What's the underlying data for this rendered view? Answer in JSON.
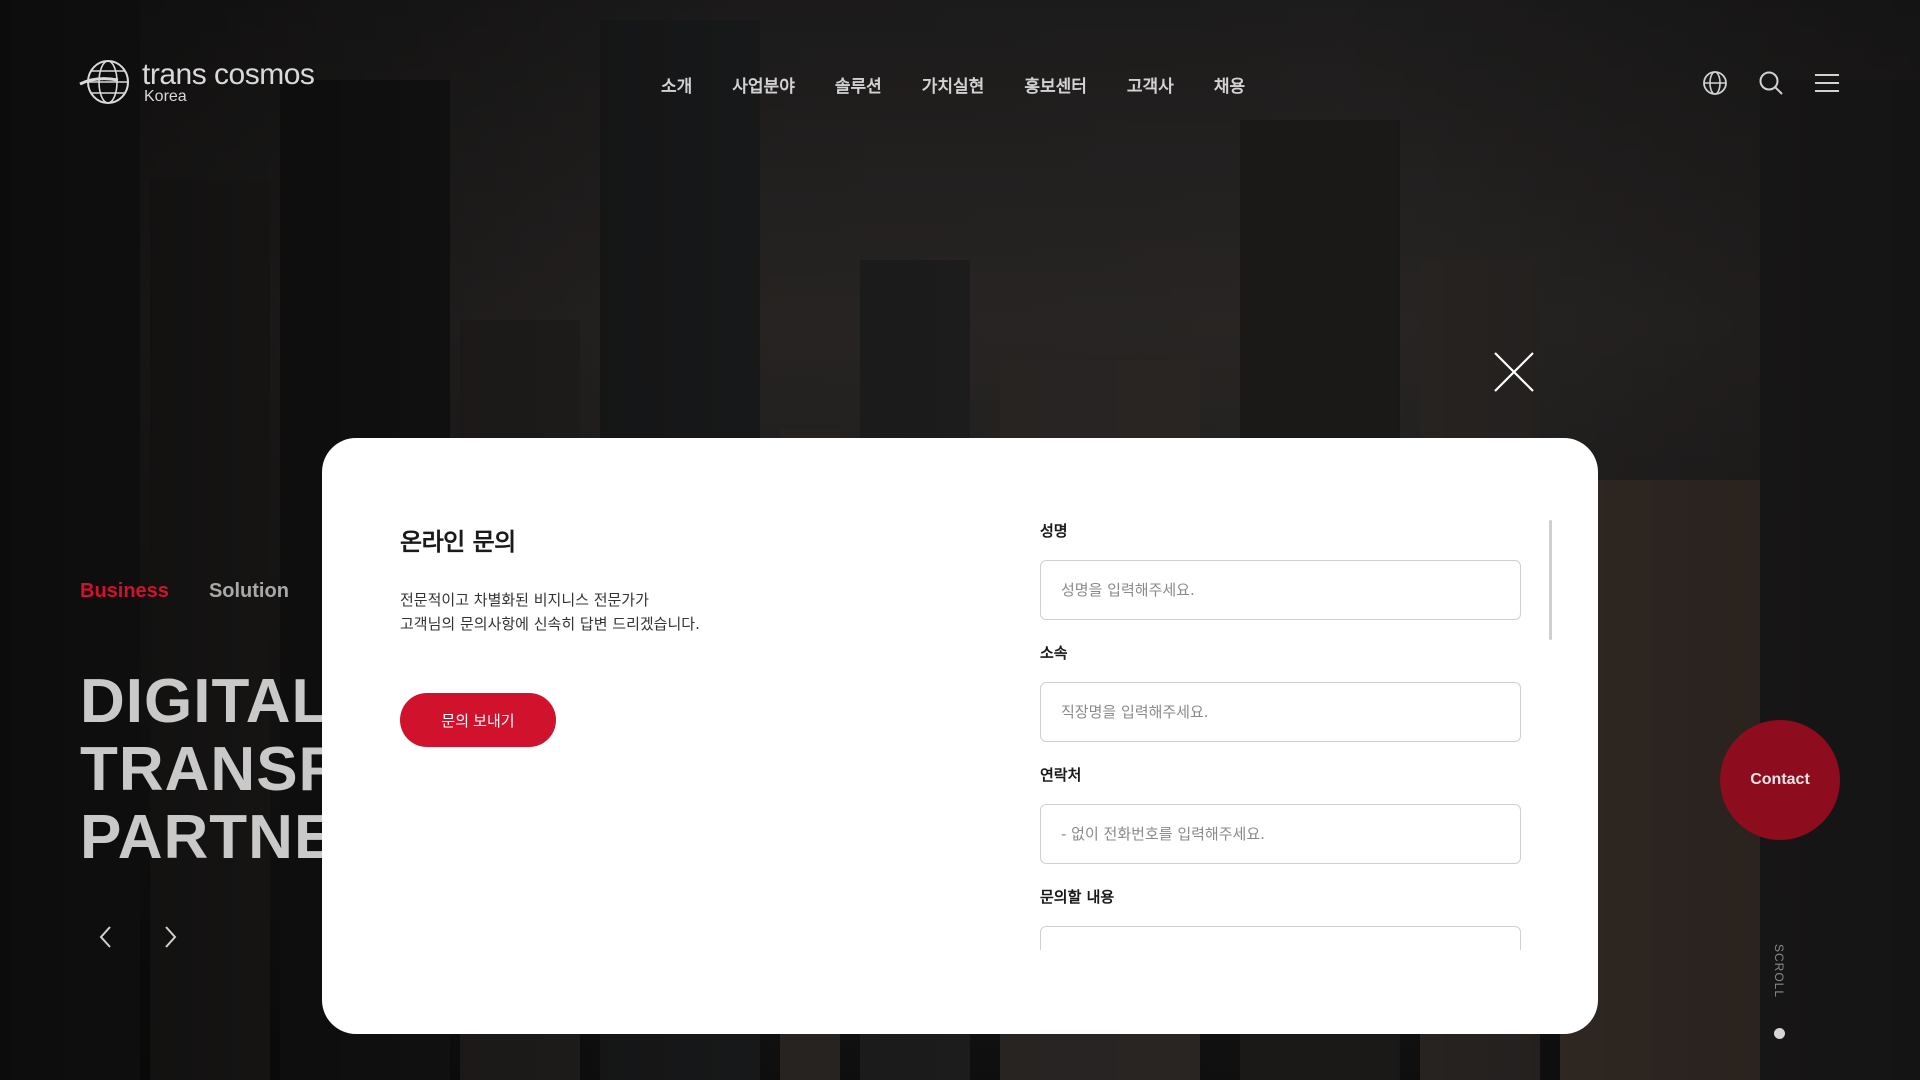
{
  "header": {
    "logo_main": "trans cosmos",
    "logo_sub": "Korea",
    "nav": [
      "소개",
      "사업분야",
      "솔루션",
      "가치실현",
      "홍보센터",
      "고객사",
      "채용"
    ],
    "icons": [
      "globe-icon",
      "search-icon",
      "menu-icon"
    ]
  },
  "hero": {
    "tabs": [
      "Business",
      "Solution"
    ],
    "title_lines": [
      "DIGITAL",
      "TRANSF",
      "PARTNE"
    ],
    "accent_color": "#d0122d"
  },
  "contact_label": "Contact",
  "scroll_label": "SCROLL",
  "modal": {
    "title": "온라인 문의",
    "desc_line1": "전문적이고 차별화된 비지니스 전문가가",
    "desc_line2": "고객님의 문의사항에 신속히 답변 드리겠습니다.",
    "submit_label": "문의 보내기",
    "fields": {
      "name_label": "성명",
      "name_placeholder": "성명을 입력해주세요.",
      "org_label": "소속",
      "org_placeholder": "직장명을 입력해주세요.",
      "phone_label": "연락처",
      "phone_placeholder": "- 없이 전화번호를 입력해주세요.",
      "content_label": "문의할 내용"
    }
  }
}
